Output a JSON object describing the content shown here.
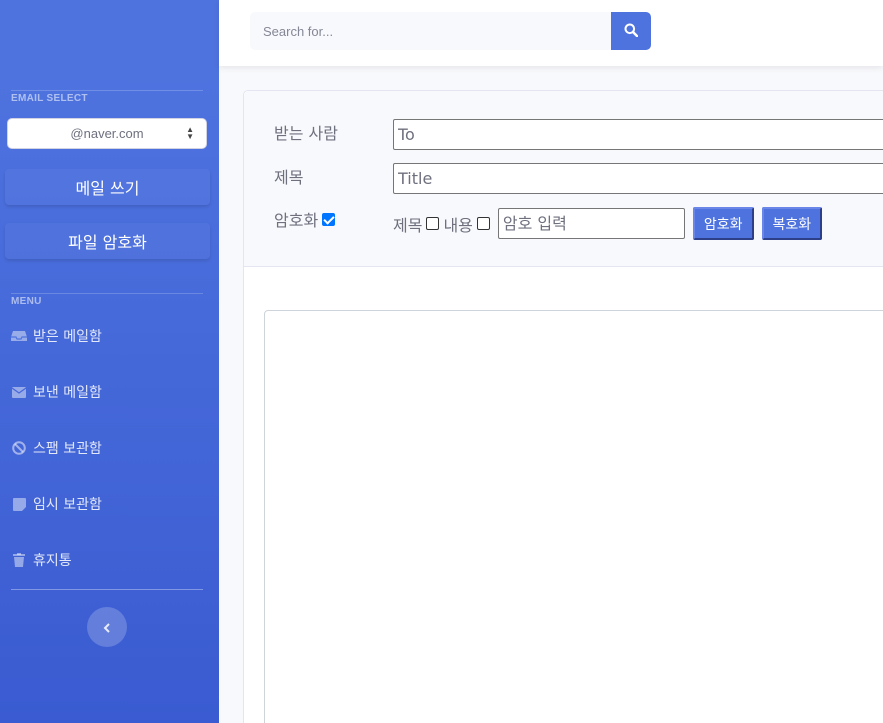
{
  "sidebar": {
    "email_heading": "EMAIL SELECT",
    "email_domain": "@naver.com",
    "compose_label": "메일 쓰기",
    "encrypt_file_label": "파일 암호화",
    "menu_heading": "MENU",
    "items": [
      {
        "label": "받은 메일함",
        "icon": "inbox-icon"
      },
      {
        "label": "보낸 메일함",
        "icon": "envelope-icon"
      },
      {
        "label": "스팸 보관함",
        "icon": "ban-icon"
      },
      {
        "label": "임시 보관함",
        "icon": "sticky-note-icon"
      },
      {
        "label": "휴지통",
        "icon": "trash-icon"
      }
    ],
    "toggle_icon": "chevron-left-icon"
  },
  "topbar": {
    "search_placeholder": "Search for...",
    "search_icon": "search-icon"
  },
  "compose": {
    "to_label": "받는 사람",
    "to_value": "To",
    "subject_label": "제목",
    "subject_value": "Title",
    "encrypt_label": "암호화",
    "encrypt_checked": true,
    "opt_subject_label": "제목",
    "opt_content_label": "내용",
    "password_placeholder": "암호 입력",
    "encrypt_button": "암호화",
    "decrypt_button": "복호화"
  },
  "colors": {
    "primary": "#4e73df",
    "sidebar_gradient_end": "#3a5bd1",
    "text_gray": "#6e707e"
  }
}
